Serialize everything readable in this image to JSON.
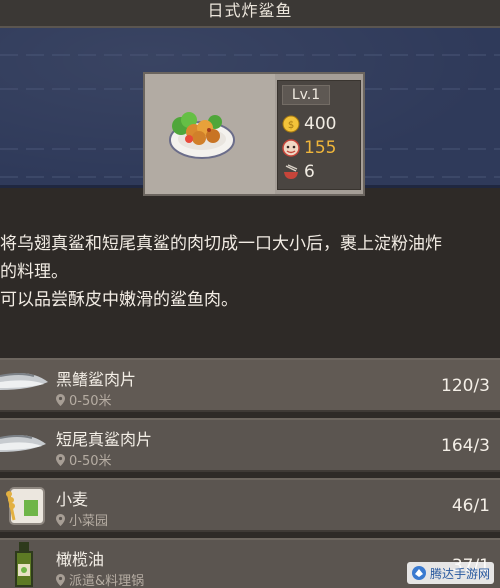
{
  "header": {
    "title": "日式炸鲨鱼"
  },
  "dish": {
    "level": "Lv.1",
    "price": "400",
    "fame": "155",
    "count": "6",
    "icons": {
      "dish": "fried-shark-dish-icon",
      "price": "gold-coin-icon",
      "fame": "fame-face-icon",
      "count": "bowl-chopsticks-icon"
    },
    "colors": {
      "fame": "#f0b63a",
      "coin": "#f3c33a"
    }
  },
  "description": {
    "lines": [
      "将乌翅真鲨和短尾真鲨的肉切成一口大小后，裹上淀粉油炸",
      "的料理。",
      "可以品尝酥皮中嫩滑的鲨鱼肉。"
    ]
  },
  "ingredients": [
    {
      "name": "黑鳍鲨肉片",
      "source": "0-50米",
      "qty": "120/3",
      "icon": "shark-fillet-icon"
    },
    {
      "name": "短尾真鲨肉片",
      "source": "0-50米",
      "qty": "164/3",
      "icon": "shark-fillet-icon"
    },
    {
      "name": "小麦",
      "source": "小菜园",
      "qty": "46/1",
      "icon": "wheat-bag-icon"
    },
    {
      "name": "橄榄油",
      "source": "派遣&料理锅",
      "qty": "37/1",
      "icon": "olive-oil-bottle-icon"
    }
  ],
  "watermark": {
    "text": "腾达手游网"
  }
}
